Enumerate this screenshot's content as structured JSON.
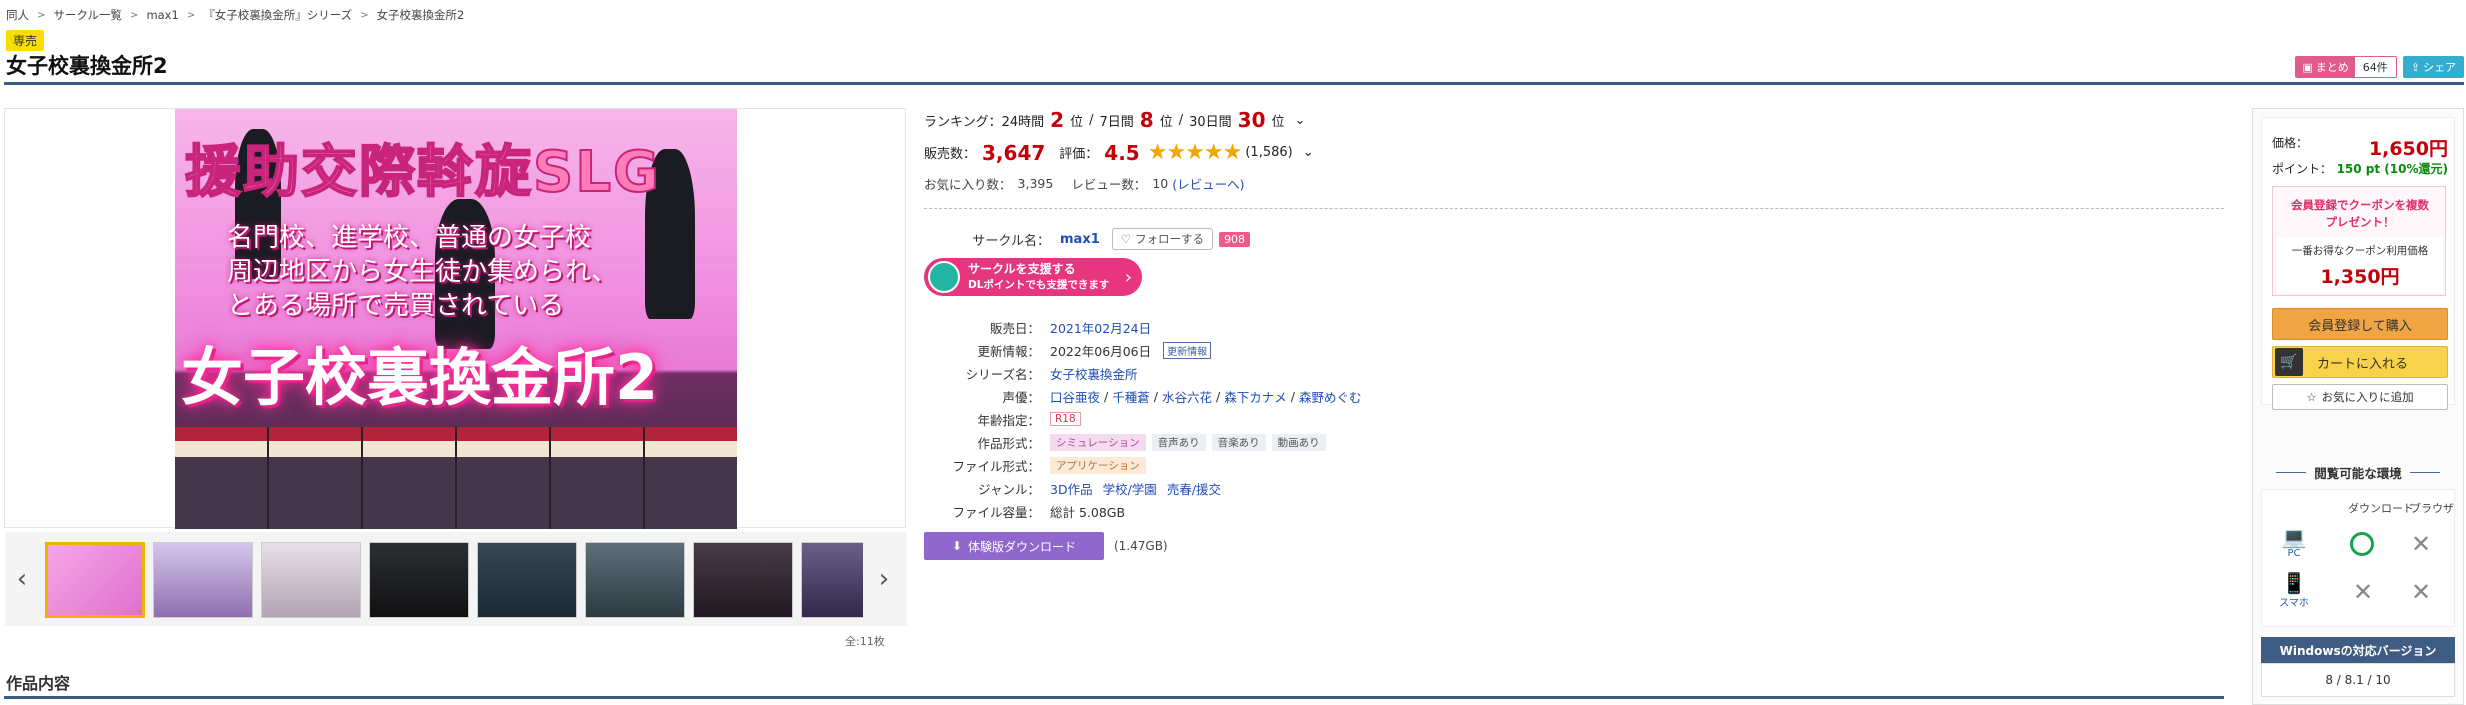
{
  "breadcrumb": [
    "同人",
    "サークル一覧",
    "max1",
    "『女子校裏換金所』シリーズ",
    "女子校裏換金所2"
  ],
  "category": "専売",
  "title": "女子校裏換金所2",
  "actions": {
    "matome_label": "まとめ",
    "matome_count": "64件",
    "share_label": "シェア"
  },
  "gallery": {
    "hero_top": "援助交際斡旋SLG",
    "hero_sub_1": "名門校、進学校、普通の女子校",
    "hero_sub_2": "周辺地区から女生徒か集められ、",
    "hero_sub_3": "とある場所で売買されている",
    "hero_title": "女子校裏換金所2",
    "total": "全:11枚",
    "thumb_count": 8
  },
  "ranking": {
    "label": "ランキング：",
    "h24_label": "24時間",
    "h24_value": "2",
    "h24_unit": "位",
    "d7_label": "7日間",
    "d7_value": "8",
    "d7_unit": "位",
    "d30_label": "30日間",
    "d30_value": "30",
    "d30_unit": "位"
  },
  "sales": {
    "label": "販売数：",
    "value": "3,647",
    "rating_label": "評価：",
    "rating_value": "4.5",
    "rating_count": "(1,586)"
  },
  "favorites": {
    "label": "お気に入り数：",
    "value": "3,395",
    "review_label": "レビュー数：",
    "review_value": "10",
    "review_link": "(レビューへ)"
  },
  "circle": {
    "label": "サークル名：",
    "name": "max1",
    "follow_label": "フォローする",
    "follow_count": "908"
  },
  "support": {
    "line1": "サークルを支援する",
    "line2": "DLポイントでも支援できます"
  },
  "specs": {
    "release_label": "販売日：",
    "release_value": "2021年02月24日",
    "update_label": "更新情報：",
    "update_value": "2022年06月06日",
    "update_tag": "更新情報",
    "series_label": "シリーズ名：",
    "series_value": "女子校裏換金所",
    "voice_label": "声優：",
    "voices": [
      "口谷亜夜",
      "千種蒼",
      "水谷六花",
      "森下カナメ",
      "森野めぐむ"
    ],
    "age_label": "年齢指定：",
    "age_value": "R18",
    "format_label": "作品形式：",
    "format_tags": [
      "シミュレーション",
      "音声あり",
      "音楽あり",
      "動画あり"
    ],
    "file_label": "ファイル形式：",
    "file_value": "アプリケーション",
    "genre_label": "ジャンル：",
    "genres": [
      "3D作品",
      "学校/学園",
      "売春/援交"
    ],
    "size_label": "ファイル容量：",
    "size_value": "総計 5.08GB"
  },
  "trial": {
    "label": "体験版ダウンロード",
    "size": "(1.47GB)"
  },
  "works_heading": "作品内容",
  "sidebar": {
    "price_label": "価格：",
    "price_value": "1,650円",
    "point_label": "ポイント：",
    "point_value": "150 pt (10%還元)",
    "coupon_line1": "会員登録でクーポンを複数",
    "coupon_line2": "プレゼント！",
    "coupon_label": "一番お得なクーポン利用価格",
    "coupon_price": "1,350円",
    "register_btn": "会員登録して購入",
    "cart_btn": "カートに入れる",
    "fav_btn": "お気に入りに追加",
    "env_heading": "閲覧可能な環境",
    "env_download": "ダウンロード",
    "env_browser": "ブラウザ",
    "env_pc": "PC",
    "env_phone": "スマホ",
    "win_heading": "Windowsの対応バージョン",
    "win_versions": "8 / 8.1 / 10"
  },
  "colors": {
    "accent": "#c4000a",
    "navy": "#3f5c82",
    "pink": "#e7367f",
    "star": "#f0a800"
  }
}
